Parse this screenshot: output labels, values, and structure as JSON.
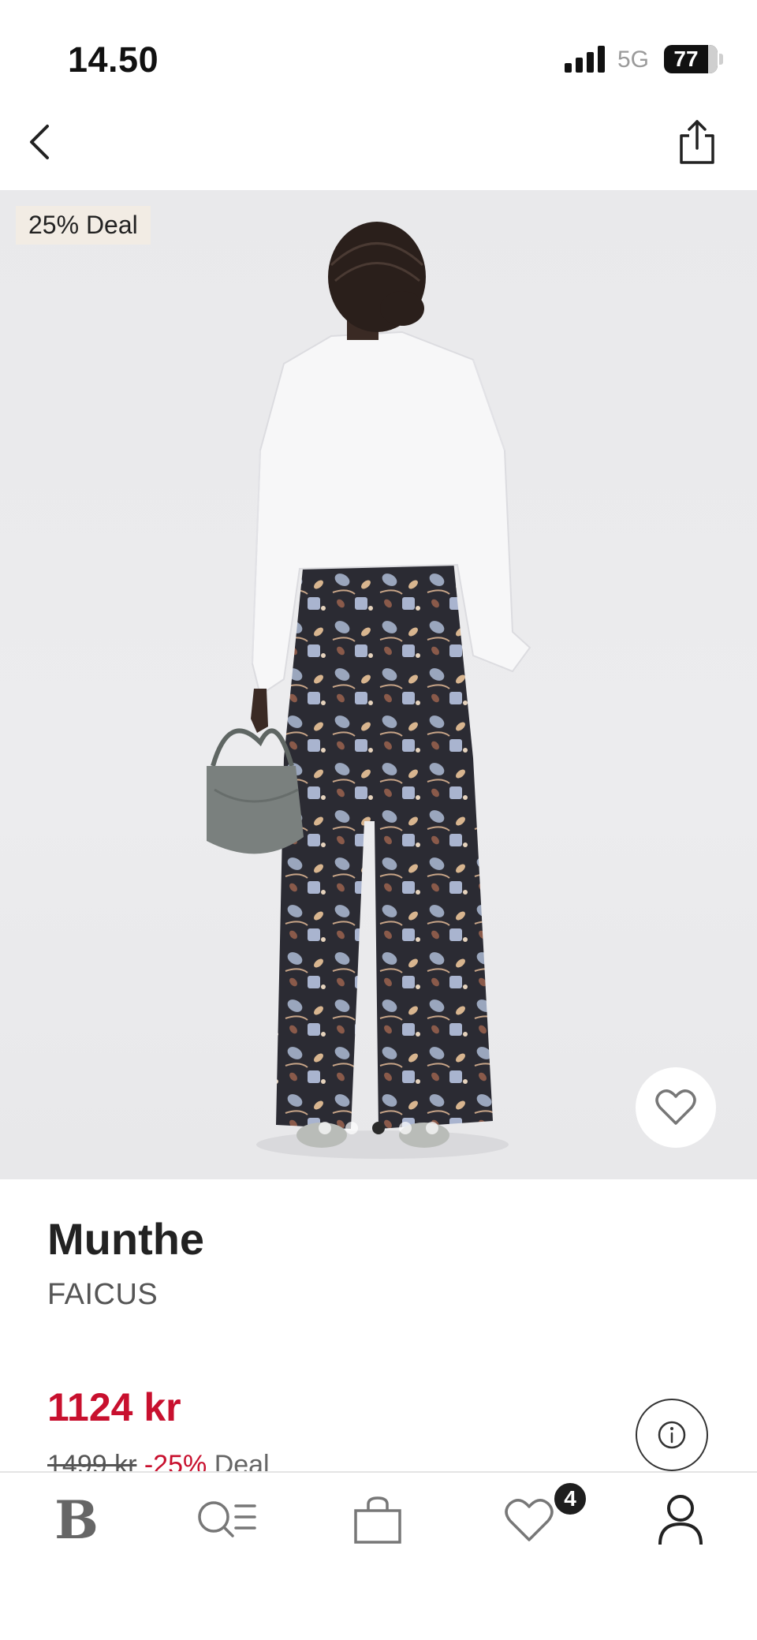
{
  "status_bar": {
    "time": "14.50",
    "network": "5G",
    "battery": "77"
  },
  "header": {
    "back_icon": "chevron-left-icon",
    "share_icon": "share-icon"
  },
  "product_image": {
    "deal_tag": "25% Deal",
    "carousel_total": 5,
    "carousel_active": 3,
    "favorite_icon": "heart-outline-icon"
  },
  "product": {
    "brand": "Munthe",
    "name": "FAICUS",
    "price": "1124 kr",
    "original_price": "1499 kr",
    "discount": "-25%",
    "deal_label": "Deal",
    "info_icon": "info-icon"
  },
  "tab_bar": {
    "home_logo": "B",
    "search_icon": "search-list-icon",
    "bag_icon": "shopping-bag-icon",
    "favorites_icon": "heart-icon",
    "favorites_count": "4",
    "account_icon": "account-icon"
  },
  "colors": {
    "price_red": "#c8102e",
    "badge_dark": "#1e1e1e",
    "deal_tag_bg": "#f2ece4"
  }
}
